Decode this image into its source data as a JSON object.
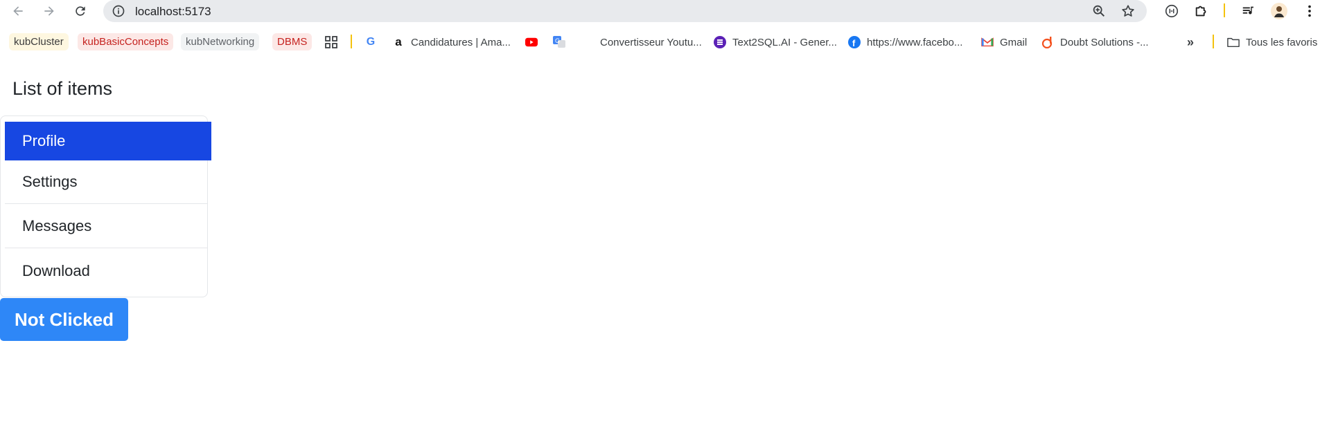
{
  "browser": {
    "url": "localhost:5173"
  },
  "bookmarks": {
    "chips": [
      {
        "label": "kubCluster",
        "style": "yellow"
      },
      {
        "label": "kubBasicConcepts",
        "style": "red"
      },
      {
        "label": "kubNetworking",
        "style": "grey"
      },
      {
        "label": "DBMS",
        "style": "red"
      }
    ],
    "links": [
      {
        "label": "Candidatures | Ama...",
        "icon": "amazon-icon"
      },
      {
        "label": "Convertisseur Youtu...",
        "icon": "none"
      },
      {
        "label": "Text2SQL.AI - Gener...",
        "icon": "text2sql-icon"
      },
      {
        "label": "https://www.facebo...",
        "icon": "facebook-icon"
      },
      {
        "label": "Gmail",
        "icon": "gmail-icon"
      },
      {
        "label": "Doubt Solutions -...",
        "icon": "doubtnut-icon"
      }
    ],
    "all_bookmarks": "Tous les favoris"
  },
  "page": {
    "heading": "List of items",
    "items": [
      {
        "label": "Profile",
        "active": true
      },
      {
        "label": "Settings",
        "active": false
      },
      {
        "label": "Messages",
        "active": false
      },
      {
        "label": "Download",
        "active": false
      }
    ],
    "button_label": "Not Clicked"
  },
  "colors": {
    "active_item": "#1747e2",
    "button": "#2e87f7"
  }
}
